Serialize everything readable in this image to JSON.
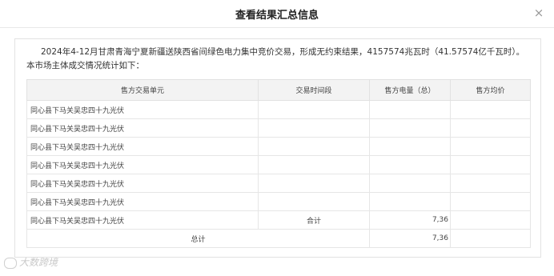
{
  "dialog": {
    "title": "查看结果汇总信息",
    "close_glyph": "×"
  },
  "summary_text": "2024年4-12月甘肃青海宁夏新疆送陕西省间绿色电力集中竞价交易，形成无约束结果，4157574兆瓦时（41.57574亿千瓦时）。本市场主体成交情况统计如下：",
  "table": {
    "headers": [
      "售方交易单元",
      "交易时间段",
      "售方电量（总）",
      "售方均价"
    ],
    "rows": [
      {
        "unit": "同心县下马关吴忠四十九光伏",
        "period": "",
        "quantity": "",
        "price": ""
      },
      {
        "unit": "同心县下马关吴忠四十九光伏",
        "period": "",
        "quantity": "",
        "price": ""
      },
      {
        "unit": "同心县下马关吴忠四十九光伏",
        "period": "",
        "quantity": "",
        "price": ""
      },
      {
        "unit": "同心县下马关吴忠四十九光伏",
        "period": "",
        "quantity": "",
        "price": ""
      },
      {
        "unit": "同心县下马关吴忠四十九光伏",
        "period": "",
        "quantity": "",
        "price": ""
      },
      {
        "unit": "同心县下马关吴忠四十九光伏",
        "period": "",
        "quantity": "",
        "price": ""
      },
      {
        "unit": "同心县下马关吴忠四十九光伏",
        "period": "合计",
        "quantity": "7,36",
        "price": ""
      }
    ],
    "total": {
      "label": "总计",
      "quantity": "7,36",
      "price": ""
    }
  },
  "watermark": "大数跨境"
}
